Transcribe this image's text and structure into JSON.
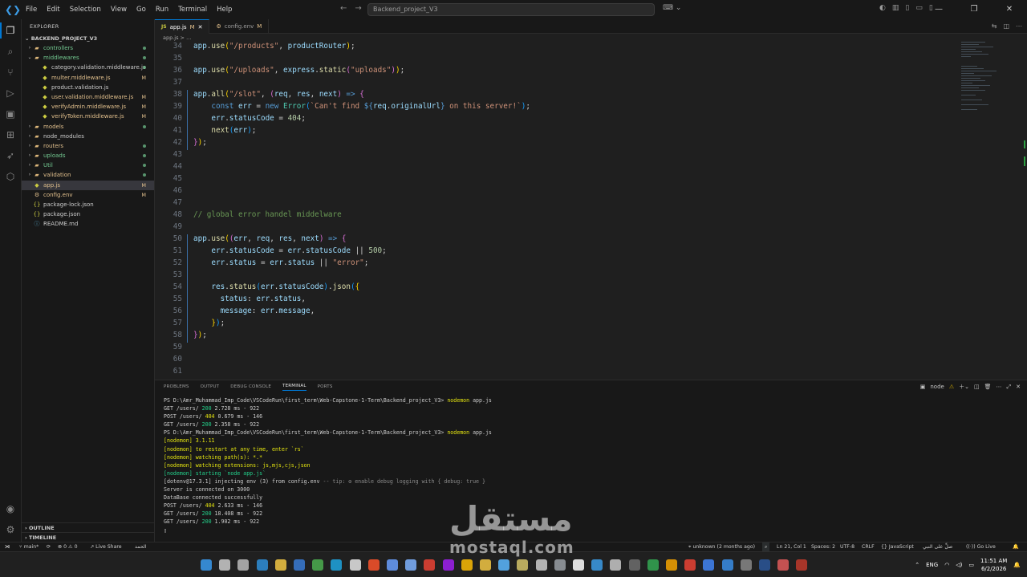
{
  "menu": [
    "File",
    "Edit",
    "Selection",
    "View",
    "Go",
    "Run",
    "Terminal",
    "Help"
  ],
  "search": {
    "placeholder": "Backend_project_V3"
  },
  "explorer": {
    "title": "EXPLORER",
    "project": "BACKEND_PROJECT_V3",
    "items": [
      {
        "label": "controllers",
        "type": "folder",
        "open": false,
        "indent": 1,
        "color": "#73c991",
        "badge": "dot"
      },
      {
        "label": "middlewares",
        "type": "folder",
        "open": true,
        "indent": 1,
        "color": "#73c991",
        "badge": "dot"
      },
      {
        "label": "category.validation.middleware.js",
        "type": "file",
        "indent": 2,
        "color": "#cccccc",
        "badge": "dot"
      },
      {
        "label": "multer.middleware.js",
        "type": "file",
        "indent": 2,
        "color": "#e2c08d",
        "badge": "M"
      },
      {
        "label": "product.validation.js",
        "type": "file",
        "indent": 2,
        "color": "#cccccc",
        "badge": ""
      },
      {
        "label": "user.validation.middleware.js",
        "type": "file",
        "indent": 2,
        "color": "#e2c08d",
        "badge": "M"
      },
      {
        "label": "verifyAdmin.middleware.js",
        "type": "file",
        "indent": 2,
        "color": "#e2c08d",
        "badge": "M"
      },
      {
        "label": "verifyToken.middleware.js",
        "type": "file",
        "indent": 2,
        "color": "#e2c08d",
        "badge": "M"
      },
      {
        "label": "models",
        "type": "folder",
        "open": false,
        "indent": 1,
        "color": "#e2c08d",
        "badge": "dot"
      },
      {
        "label": "node_modules",
        "type": "folder",
        "open": false,
        "indent": 1,
        "color": "#cccccc",
        "badge": ""
      },
      {
        "label": "routers",
        "type": "folder",
        "open": false,
        "indent": 1,
        "color": "#e2c08d",
        "badge": "dot"
      },
      {
        "label": "uploads",
        "type": "folder",
        "open": false,
        "indent": 1,
        "color": "#73c991",
        "badge": "dot"
      },
      {
        "label": "Util",
        "type": "folder",
        "open": false,
        "indent": 1,
        "color": "#73c991",
        "badge": "dot"
      },
      {
        "label": "validation",
        "type": "folder",
        "open": false,
        "indent": 1,
        "color": "#e2c08d",
        "badge": "dot"
      },
      {
        "label": "app.js",
        "type": "file",
        "indent": 1,
        "color": "#e2c08d",
        "badge": "M",
        "selected": true
      },
      {
        "label": "config.env",
        "type": "file",
        "indent": 1,
        "color": "#e2c08d",
        "badge": "M"
      },
      {
        "label": "package-lock.json",
        "type": "file",
        "indent": 1,
        "color": "#cccccc",
        "badge": ""
      },
      {
        "label": "package.json",
        "type": "file",
        "indent": 1,
        "color": "#cccccc",
        "badge": ""
      },
      {
        "label": "README.md",
        "type": "file",
        "indent": 1,
        "color": "#cccccc",
        "badge": ""
      }
    ],
    "outline": "OUTLINE",
    "timeline": "TIMELINE"
  },
  "tabs": [
    {
      "label": "app.js",
      "mod": "M",
      "active": true
    },
    {
      "label": "config.env",
      "mod": "M",
      "active": false
    }
  ],
  "breadcrumb": "app.js > ...",
  "code": [
    {
      "n": "34",
      "t": [
        [
          "app",
          "var"
        ],
        [
          ".",
          ""
        ],
        [
          "use",
          "fn"
        ],
        [
          "(",
          "b1"
        ],
        [
          "\"/products\"",
          "str"
        ],
        [
          ", ",
          "p"
        ],
        [
          "productRouter",
          "var"
        ],
        [
          ")",
          "b1"
        ],
        [
          ";",
          "p"
        ]
      ]
    },
    {
      "n": "35",
      "t": []
    },
    {
      "n": "36",
      "t": [
        [
          "app",
          "var"
        ],
        [
          ".",
          "p"
        ],
        [
          "use",
          "fn"
        ],
        [
          "(",
          "b1"
        ],
        [
          "\"/uploads\"",
          "str"
        ],
        [
          ", ",
          "p"
        ],
        [
          "express",
          "var"
        ],
        [
          ".",
          "p"
        ],
        [
          "static",
          "fn"
        ],
        [
          "(",
          "b2"
        ],
        [
          "\"uploads\"",
          "str"
        ],
        [
          ")",
          "b2"
        ],
        [
          ")",
          "b1"
        ],
        [
          ";",
          "p"
        ]
      ]
    },
    {
      "n": "37",
      "t": []
    },
    {
      "n": "38",
      "t": [
        [
          "app",
          "var"
        ],
        [
          ".",
          "p"
        ],
        [
          "all",
          "fn"
        ],
        [
          "(",
          "b1"
        ],
        [
          "\"/slot\"",
          "str"
        ],
        [
          ", ",
          "p"
        ],
        [
          "(",
          "b2"
        ],
        [
          "req",
          "var"
        ],
        [
          ", ",
          "p"
        ],
        [
          "res",
          "var"
        ],
        [
          ", ",
          "p"
        ],
        [
          "next",
          "var"
        ],
        [
          ")",
          "b2"
        ],
        [
          " => ",
          "kw"
        ],
        [
          "{",
          "b2"
        ]
      ]
    },
    {
      "n": "39",
      "t": [
        [
          "    const ",
          "kw"
        ],
        [
          "err",
          "var"
        ],
        [
          " = ",
          "p"
        ],
        [
          "new ",
          "kw"
        ],
        [
          "Error",
          "cls"
        ],
        [
          "(",
          "b3"
        ],
        [
          "`Can't find ",
          "tpl"
        ],
        [
          "${",
          "kw"
        ],
        [
          "req",
          "var"
        ],
        [
          ".",
          "p"
        ],
        [
          "originalUrl",
          "var"
        ],
        [
          "}",
          "kw"
        ],
        [
          " on this server!`",
          "tpl"
        ],
        [
          ")",
          "b3"
        ],
        [
          ";",
          "p"
        ]
      ]
    },
    {
      "n": "40",
      "t": [
        [
          "    err",
          "var"
        ],
        [
          ".",
          "p"
        ],
        [
          "statusCode",
          "var"
        ],
        [
          " = ",
          "p"
        ],
        [
          "404",
          "num"
        ],
        [
          ";",
          "p"
        ]
      ]
    },
    {
      "n": "41",
      "t": [
        [
          "    next",
          "fn"
        ],
        [
          "(",
          "b3"
        ],
        [
          "err",
          "var"
        ],
        [
          ")",
          "b3"
        ],
        [
          ";",
          "p"
        ]
      ]
    },
    {
      "n": "42",
      "t": [
        [
          "}",
          "b2"
        ],
        [
          ")",
          "b1"
        ],
        [
          ";",
          "p"
        ]
      ]
    },
    {
      "n": "43",
      "t": []
    },
    {
      "n": "44",
      "t": []
    },
    {
      "n": "45",
      "t": []
    },
    {
      "n": "46",
      "t": []
    },
    {
      "n": "47",
      "t": []
    },
    {
      "n": "48",
      "t": [
        [
          "// global error handel middelware",
          "com"
        ]
      ]
    },
    {
      "n": "49",
      "t": []
    },
    {
      "n": "50",
      "t": [
        [
          "app",
          "var"
        ],
        [
          ".",
          "p"
        ],
        [
          "use",
          "fn"
        ],
        [
          "(",
          "b1"
        ],
        [
          "(",
          "b2"
        ],
        [
          "err",
          "var"
        ],
        [
          ", ",
          "p"
        ],
        [
          "req",
          "var"
        ],
        [
          ", ",
          "p"
        ],
        [
          "res",
          "var"
        ],
        [
          ", ",
          "p"
        ],
        [
          "next",
          "var"
        ],
        [
          ")",
          "b2"
        ],
        [
          " => ",
          "kw"
        ],
        [
          "{",
          "b2"
        ]
      ]
    },
    {
      "n": "51",
      "t": [
        [
          "    err",
          "var"
        ],
        [
          ".",
          "p"
        ],
        [
          "statusCode",
          "var"
        ],
        [
          " = ",
          "p"
        ],
        [
          "err",
          "var"
        ],
        [
          ".",
          "p"
        ],
        [
          "statusCode",
          "var"
        ],
        [
          " || ",
          "p"
        ],
        [
          "500",
          "num"
        ],
        [
          ";",
          "p"
        ]
      ]
    },
    {
      "n": "52",
      "t": [
        [
          "    err",
          "var"
        ],
        [
          ".",
          "p"
        ],
        [
          "status",
          "var"
        ],
        [
          " = ",
          "p"
        ],
        [
          "err",
          "var"
        ],
        [
          ".",
          "p"
        ],
        [
          "status",
          "var"
        ],
        [
          " || ",
          "p"
        ],
        [
          "\"error\"",
          "str"
        ],
        [
          ";",
          "p"
        ]
      ]
    },
    {
      "n": "53",
      "t": []
    },
    {
      "n": "54",
      "t": [
        [
          "    res",
          "var"
        ],
        [
          ".",
          "p"
        ],
        [
          "status",
          "fn"
        ],
        [
          "(",
          "b3"
        ],
        [
          "err",
          "var"
        ],
        [
          ".",
          "p"
        ],
        [
          "statusCode",
          "var"
        ],
        [
          ")",
          "b3"
        ],
        [
          ".",
          "p"
        ],
        [
          "json",
          "fn"
        ],
        [
          "(",
          "b3"
        ],
        [
          "{",
          "b1"
        ]
      ]
    },
    {
      "n": "55",
      "t": [
        [
          "      status",
          "var"
        ],
        [
          ": ",
          "p"
        ],
        [
          "err",
          "var"
        ],
        [
          ".",
          "p"
        ],
        [
          "status",
          "var"
        ],
        [
          ",",
          "p"
        ]
      ]
    },
    {
      "n": "56",
      "t": [
        [
          "      message",
          "var"
        ],
        [
          ": ",
          "p"
        ],
        [
          "err",
          "var"
        ],
        [
          ".",
          "p"
        ],
        [
          "message",
          "var"
        ],
        [
          ",",
          "p"
        ]
      ]
    },
    {
      "n": "57",
      "t": [
        [
          "    }",
          "b1"
        ],
        [
          ")",
          "b3"
        ],
        [
          ";",
          "p"
        ]
      ]
    },
    {
      "n": "58",
      "t": [
        [
          "}",
          "b2"
        ],
        [
          ")",
          "b1"
        ],
        [
          ";",
          "p"
        ]
      ]
    },
    {
      "n": "59",
      "t": []
    },
    {
      "n": "60",
      "t": []
    },
    {
      "n": "61",
      "t": []
    }
  ],
  "panel": {
    "tabs": [
      "PROBLEMS",
      "OUTPUT",
      "DEBUG CONSOLE",
      "TERMINAL",
      "PORTS"
    ],
    "active_tab": "TERMINAL",
    "terminal_name": "node",
    "lines": [
      [
        [
          "PS D:\\Amr_Muhammad_Imp_Code\\VSCodeRun\\first_term\\Web-Capstone-1-Term\\Backend_project_V3> ",
          ""
        ],
        [
          "nodemon",
          "y"
        ],
        [
          " app.js",
          ""
        ]
      ],
      [
        [
          "GET /users/ ",
          ""
        ],
        [
          "200",
          "g"
        ],
        [
          " 2.728 ms - 922",
          ""
        ]
      ],
      [
        [
          "POST /users/ ",
          ""
        ],
        [
          "404",
          "y"
        ],
        [
          " 0.679 ms - 146",
          ""
        ]
      ],
      [
        [
          "GET /users/ ",
          ""
        ],
        [
          "200",
          "g"
        ],
        [
          " 2.358 ms - 922",
          ""
        ]
      ],
      [
        [
          "PS D:\\Amr_Muhammad_Imp_Code\\VSCodeRun\\first_term\\Web-Capstone-1-Term\\Backend_project_V3> ",
          ""
        ],
        [
          "nodemon",
          "y"
        ],
        [
          " app.js",
          ""
        ]
      ],
      [
        [
          "[nodemon] 3.1.11",
          "y"
        ]
      ],
      [
        [
          "[nodemon] to restart at any time, enter `rs`",
          "y"
        ]
      ],
      [
        [
          "[nodemon] watching path(s): *.*",
          "y"
        ]
      ],
      [
        [
          "[nodemon] watching extensions: js,mjs,cjs,json",
          "y"
        ]
      ],
      [
        [
          "[nodemon] starting `node app.js`",
          "g"
        ]
      ],
      [
        [
          "[dotenv@17.3.1] injecting env (3) from config.env ",
          ""
        ],
        [
          "-- tip: ⚙ enable debug logging with { debug: true }",
          "gr"
        ]
      ],
      [
        [
          "Server is connected on 3000",
          ""
        ]
      ],
      [
        [
          "DataBase connected successfully",
          ""
        ]
      ],
      [
        [
          "POST /users/ ",
          ""
        ],
        [
          "404",
          "y"
        ],
        [
          " 2.633 ms - 146",
          ""
        ]
      ],
      [
        [
          "GET /users/ ",
          ""
        ],
        [
          "200",
          "g"
        ],
        [
          " 18.408 ms - 922",
          ""
        ]
      ],
      [
        [
          "GET /users/ ",
          ""
        ],
        [
          "200",
          "g"
        ],
        [
          " 1.902 ms - 922",
          ""
        ]
      ],
      [
        [
          "▯",
          ""
        ]
      ]
    ]
  },
  "status": {
    "branch": "main*",
    "errors": "0",
    "warnings": "0",
    "ports": "0",
    "liveshare": "Live Share",
    "arabic_left": "الحمد",
    "blame": "unknown (2 months ago)",
    "position": "Ln 21, Col 1",
    "spaces": "Spaces: 2",
    "encoding": "UTF-8",
    "eol": "CRLF",
    "language": "JavaScript",
    "arabic_right": "صلِّ على النبي",
    "golive": "Go Live"
  },
  "taskbar": {
    "lang": "ENG",
    "time": "11:51 AM",
    "date": "6/2/2026"
  },
  "watermark": {
    "arabic": "مستقل",
    "latin": "mostaql.com"
  }
}
